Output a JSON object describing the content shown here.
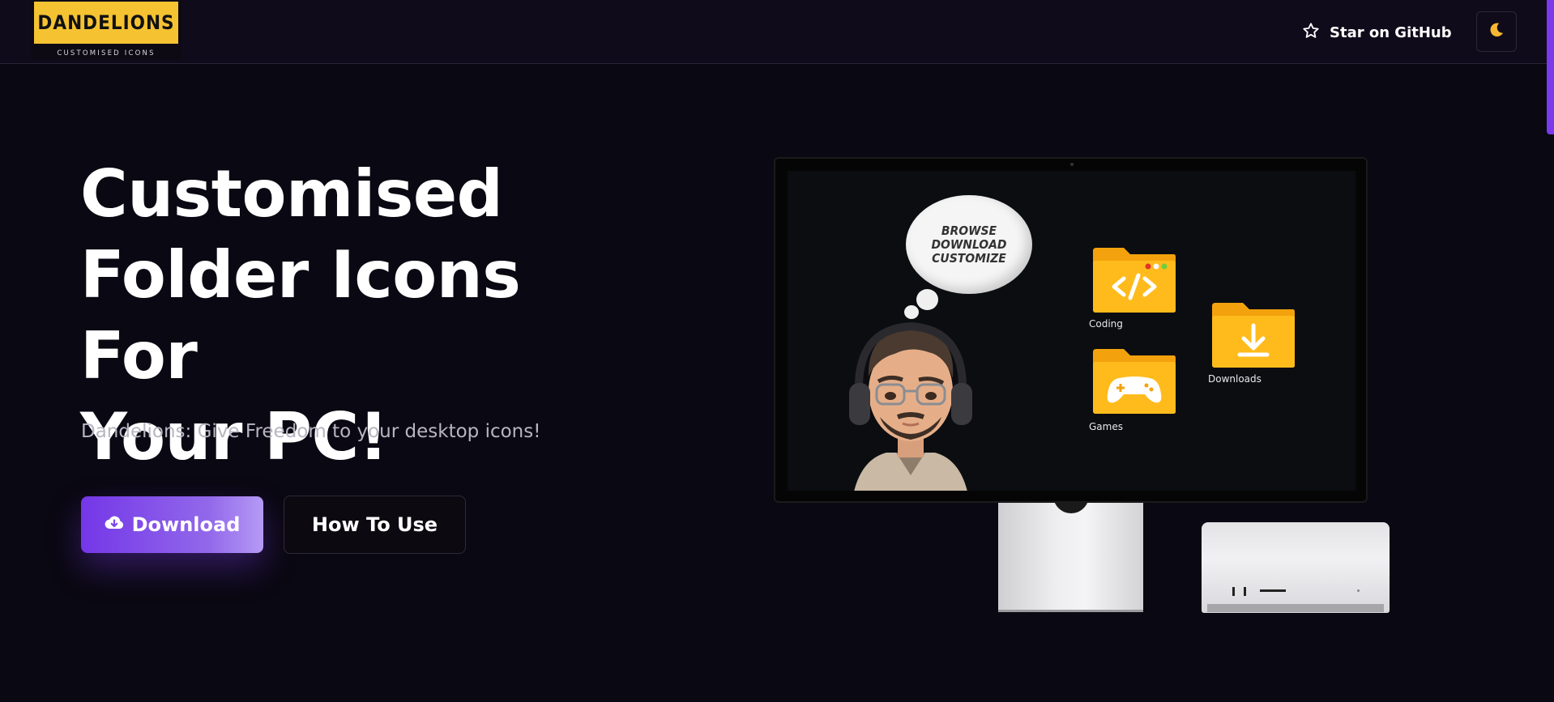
{
  "header": {
    "logo_text": "DANDELIONS",
    "logo_subtext": "CUSTOMISED ICONS",
    "github_label": "Star on GitHub",
    "star_icon": "star-outline-icon",
    "theme_icon": "moon-icon"
  },
  "hero": {
    "title_line1": "Customised",
    "title_line2": "Folder Icons For",
    "title_line3": "Your PC!",
    "subtitle": "Dandelions: Give Freedom to your desktop icons!",
    "download_label": "Download",
    "download_icon": "cloud-download-icon",
    "howto_label": "How To Use"
  },
  "illustration": {
    "bubble_line1": "BROWSE",
    "bubble_line2": "DOWNLOAD",
    "bubble_line3": "CUSTOMIZE",
    "folders": [
      {
        "label": "Coding",
        "icon": "code-icon"
      },
      {
        "label": "Games",
        "icon": "gamepad-icon"
      },
      {
        "label": "Downloads",
        "icon": "download-arrow-icon"
      }
    ]
  },
  "colors": {
    "background": "#0a0812",
    "accent": "#7c3aed",
    "logo": "#f5c232",
    "folder": "#fdb10f",
    "moon": "#f7b733"
  }
}
